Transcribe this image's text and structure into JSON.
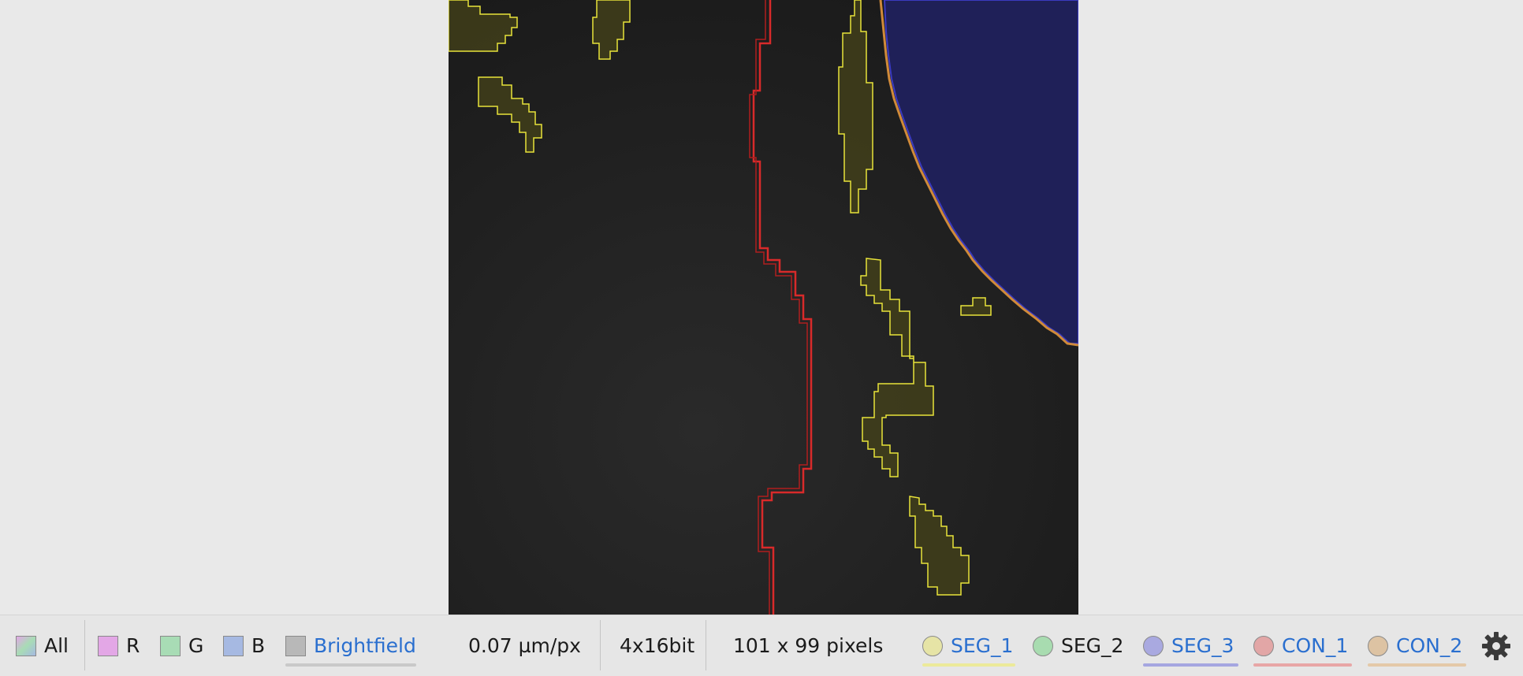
{
  "toolbar": {
    "channels": [
      {
        "key": "all",
        "label": "All",
        "color": "#9fc6c8"
      },
      {
        "key": "r",
        "label": "R",
        "color": "#e3a7e6"
      },
      {
        "key": "g",
        "label": "G",
        "color": "#a8dcb5"
      },
      {
        "key": "b",
        "label": "B",
        "color": "#a6b9e2"
      },
      {
        "key": "brightfield",
        "label": "Brightfield",
        "color": "#b8b8b8"
      }
    ],
    "scale": "0.07 µm/px",
    "bit_depth": "4x16bit",
    "dimensions": "101 x 99 pixels",
    "overlays": [
      {
        "label": "SEG_1",
        "color": "#e6e4a6",
        "underline": "#e6e4a6",
        "active": true
      },
      {
        "label": "SEG_2",
        "color": "#a8dcb0",
        "underline": "",
        "active": false
      },
      {
        "label": "SEG_3",
        "color": "#a9a9e0",
        "underline": "#a9a9e0",
        "active": true
      },
      {
        "label": "CON_1",
        "color": "#e2a6a6",
        "underline": "#e2a6a6",
        "active": true
      },
      {
        "label": "CON_2",
        "color": "#ddc3a3",
        "underline": "#ddc3a3",
        "active": true
      }
    ],
    "settings_icon": "gear-icon"
  },
  "colors": {
    "seg_yellow": "#e8e33a",
    "con_red": "#d82a2a",
    "seg_blue": "#1f2058",
    "link": "#2a6fcf"
  }
}
